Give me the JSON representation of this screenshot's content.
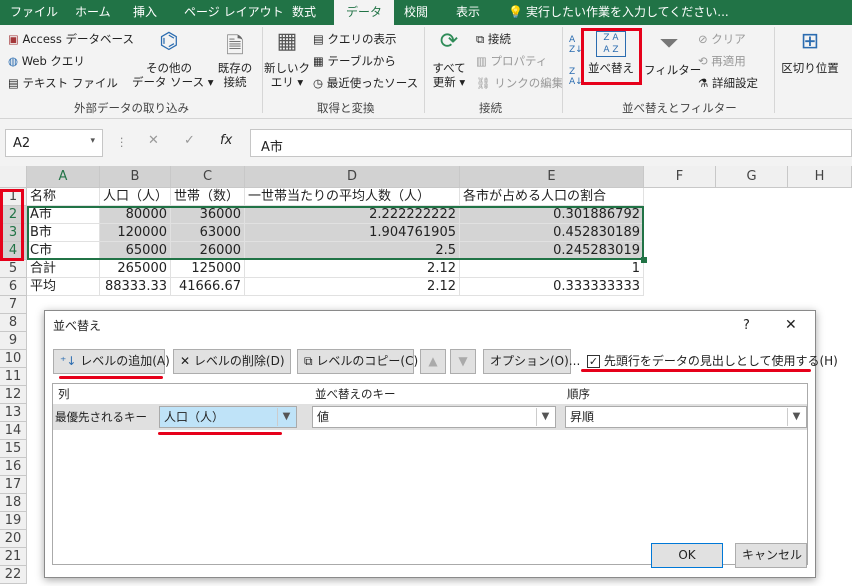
{
  "tabs": [
    "ファイル",
    "ホーム",
    "挿入",
    "ページ レイアウト",
    "数式",
    "データ",
    "校閲",
    "表示",
    "実行したい作業を入力してください..."
  ],
  "ribbon": {
    "access": "Access データベース",
    "web": "Web クエリ",
    "text": "テキスト ファイル",
    "other_sources_1": "その他の",
    "other_sources_2": "データ ソース ▾",
    "existing_1": "既存の",
    "existing_2": "接続",
    "new_query_1": "新しいク",
    "new_query_2": "エリ ▾",
    "show_query": "クエリの表示",
    "from_table": "テーブルから",
    "recent_sources": "最近使ったソース",
    "refresh_1": "すべて",
    "refresh_2": "更新 ▾",
    "connections": "接続",
    "properties": "プロパティ",
    "edit_links": "リンクの編集",
    "sort": "並べ替え",
    "filter": "フィルター",
    "clear": "クリア",
    "reapply": "再適用",
    "advanced": "詳細設定",
    "text_to_columns": "区切り位置",
    "group_external": "外部データの取り込み",
    "group_get": "取得と変換",
    "group_conn": "接続",
    "group_sort": "並べ替えとフィルター"
  },
  "name_box": "A2",
  "cancel_sym": "✕",
  "enter_sym": "✓",
  "fx_label": "fx",
  "formula": "A市",
  "columns": [
    "A",
    "B",
    "C",
    "D",
    "E",
    "F",
    "G",
    "H"
  ],
  "rows": [
    "1",
    "2",
    "3",
    "4",
    "5",
    "6",
    "7",
    "8",
    "9",
    "10",
    "11",
    "12",
    "13",
    "14",
    "15",
    "16",
    "17",
    "18",
    "19",
    "20",
    "21",
    "22"
  ],
  "sheet": [
    [
      "名称",
      "人口（人）",
      "世帯（数）",
      "一世帯当たりの平均人数（人）",
      "各市が占める人口の割合"
    ],
    [
      "A市",
      "80000",
      "36000",
      "2.222222222",
      "0.301886792"
    ],
    [
      "B市",
      "120000",
      "63000",
      "1.904761905",
      "0.452830189"
    ],
    [
      "C市",
      "65000",
      "26000",
      "2.5",
      "0.245283019"
    ],
    [
      "合計",
      "265000",
      "125000",
      "2.12",
      "1"
    ],
    [
      "平均",
      "88333.33",
      "41666.67",
      "2.12",
      "0.333333333"
    ]
  ],
  "dialog": {
    "title": "並べ替え",
    "help": "?",
    "close": "✕",
    "add_level": "レベルの追加(A)",
    "delete_level": "レベルの削除(D)",
    "copy_level": "レベルのコピー(C)",
    "up": "▲",
    "down": "▼",
    "options": "オプション(O)...",
    "header_checkbox": "先頭行をデータの見出しとして使用する(H)",
    "col_header": "列",
    "key_header": "並べ替えのキー",
    "order_header": "順序",
    "row_label": "最優先されるキー",
    "column_value": "人口（人）",
    "key_value": "値",
    "order_value": "昇順",
    "ok": "OK",
    "cancel": "キャンセル"
  }
}
